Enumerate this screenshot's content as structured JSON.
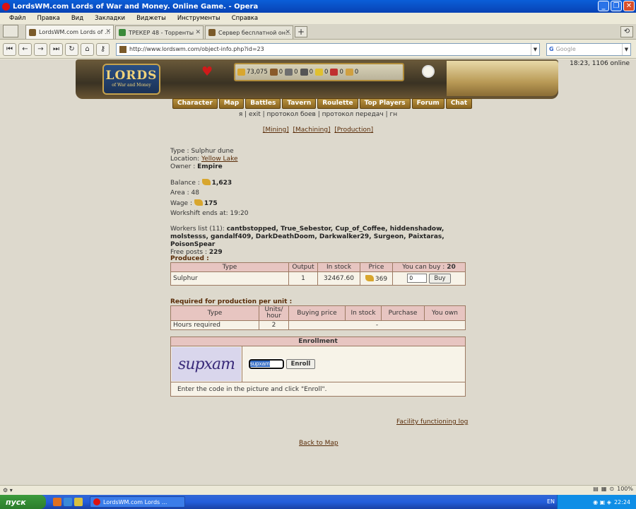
{
  "window": {
    "title": "LordsWM.com Lords of War and Money. Online Game. - Opera"
  },
  "menu": [
    "Файл",
    "Правка",
    "Вид",
    "Закладки",
    "Виджеты",
    "Инструменты",
    "Справка"
  ],
  "tabs": [
    {
      "label": "LordsWM.com Lords of ..."
    },
    {
      "label": "ТРЕКЕР 48 - Торренты"
    },
    {
      "label": "Сервер бесплатной он..."
    }
  ],
  "address": {
    "url": "http://www.lordswm.com/object-info.php?id=23",
    "search_placeholder": "Google"
  },
  "header": {
    "logo_big": "LORDS",
    "logo_small": "of War and Money",
    "online": "18:23, 1106 online",
    "resources": [
      {
        "icon": "gold-icon",
        "value": "73,075",
        "color": "#d8a62e"
      },
      {
        "icon": "wood-icon",
        "value": "0",
        "color": "#8a5a2a"
      },
      {
        "icon": "ore-icon",
        "value": "0",
        "color": "#6f6f6f"
      },
      {
        "icon": "mercury-icon",
        "value": "0",
        "color": "#555555"
      },
      {
        "icon": "sulphur-icon",
        "value": "0",
        "color": "#e0c030"
      },
      {
        "icon": "crystal-icon",
        "value": "0",
        "color": "#c03030"
      },
      {
        "icon": "gems-icon",
        "value": "0",
        "color": "#d0a040"
      }
    ]
  },
  "nav": [
    "Character",
    "Map",
    "Battles",
    "Tavern",
    "Roulette",
    "Top Players",
    "Forum",
    "Chat"
  ],
  "sublinks": "я | exit | протокол боев | протокол передач | гн",
  "categories": [
    "[Mining]",
    "[Machining]",
    "[Production]"
  ],
  "facility": {
    "type_label": "Type : ",
    "type_value": "Sulphur dune",
    "location_label": "Location: ",
    "location_value": "Yellow Lake",
    "owner_label": "Owner : ",
    "owner_value": "Empire",
    "balance_label": "Balance : ",
    "balance_value": "1,623",
    "area_label": "Area : ",
    "area_value": "48",
    "wage_label": "Wage : ",
    "wage_value": "175",
    "workshift_label": "Workshift ends at: ",
    "workshift_value": "19:20",
    "workers_label": "Workers list (11): ",
    "workers": "cantbstopped, True_Sebestor, Cup_of_Coffee, hiddenshadow, molstesss, gandalf409, DarkDeathDoom, Darkwalker29, Surgeon, Paixtaras, PoisonSpear",
    "free_posts_label": "Free posts : ",
    "free_posts_value": "229"
  },
  "produced": {
    "title": "Produced :",
    "headers": [
      "Type",
      "Output",
      "In stock",
      "Price",
      "You can buy : "
    ],
    "can_buy": "20",
    "row": {
      "type": "Sulphur",
      "output": "1",
      "in_stock": "32467.60",
      "price": "369",
      "qty": "0",
      "buy_label": "Buy"
    }
  },
  "required": {
    "title": "Required for production per unit :",
    "headers": [
      "Type",
      "Units/ hour",
      "Buying price",
      "In stock",
      "Purchase",
      "You own"
    ],
    "row": {
      "type": "Hours required",
      "units": "2",
      "rest": "-"
    }
  },
  "enrollment": {
    "title": "Enrollment",
    "captcha_text": "supxam",
    "code_value": "supxam",
    "button": "Enroll",
    "hint": "Enter the code in the picture and click \"Enroll\"."
  },
  "links": {
    "log": "Facility functioning log",
    "back": "Back to Map"
  },
  "status": {
    "zoom": "100%"
  },
  "taskbar": {
    "start": "пуск",
    "item": "LordsWM.com Lords ...",
    "lang": "EN",
    "time": "22:24"
  }
}
